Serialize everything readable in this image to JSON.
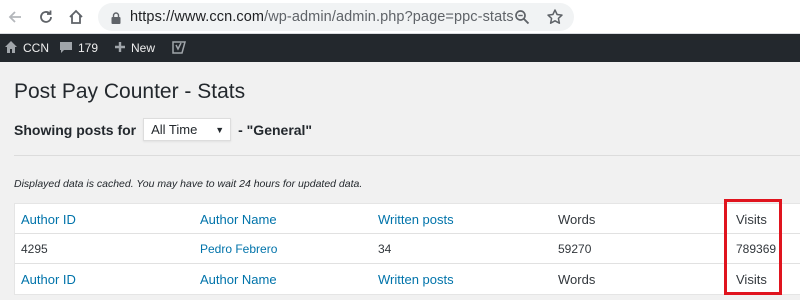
{
  "browser": {
    "url_main": "https://www.ccn.com",
    "url_rest": "/wp-admin/admin.php?page=ppc-stats",
    "icons": [
      "back-arrow-icon",
      "reload-icon",
      "home-icon",
      "lock-icon",
      "zoom-icon",
      "star-icon"
    ]
  },
  "adminbar": {
    "site_name": "CCN",
    "comments_count": "179",
    "new_label": "New",
    "icons": [
      "house-icon",
      "comment-bubble-icon",
      "plus-icon",
      "yoast-icon"
    ]
  },
  "page": {
    "title": "Post Pay Counter - Stats",
    "showing_label": "Showing posts for",
    "time_range": "All Time",
    "filter_suffix": "- \"General\"",
    "cache_note": "Displayed data is cached. You may have to wait 24 hours for updated data."
  },
  "table": {
    "columns": [
      "Author ID",
      "Author Name",
      "Written posts",
      "Words",
      "Visits"
    ],
    "rows": [
      {
        "author_id": "4295",
        "author_name": "Pedro Febrero",
        "written_posts": "34",
        "words": "59270",
        "visits": "789369"
      }
    ]
  },
  "colors": {
    "adminbar_bg": "#23282d",
    "link": "#0073aa",
    "highlight": "#e0141e",
    "page_bg": "#f1f1f1"
  }
}
